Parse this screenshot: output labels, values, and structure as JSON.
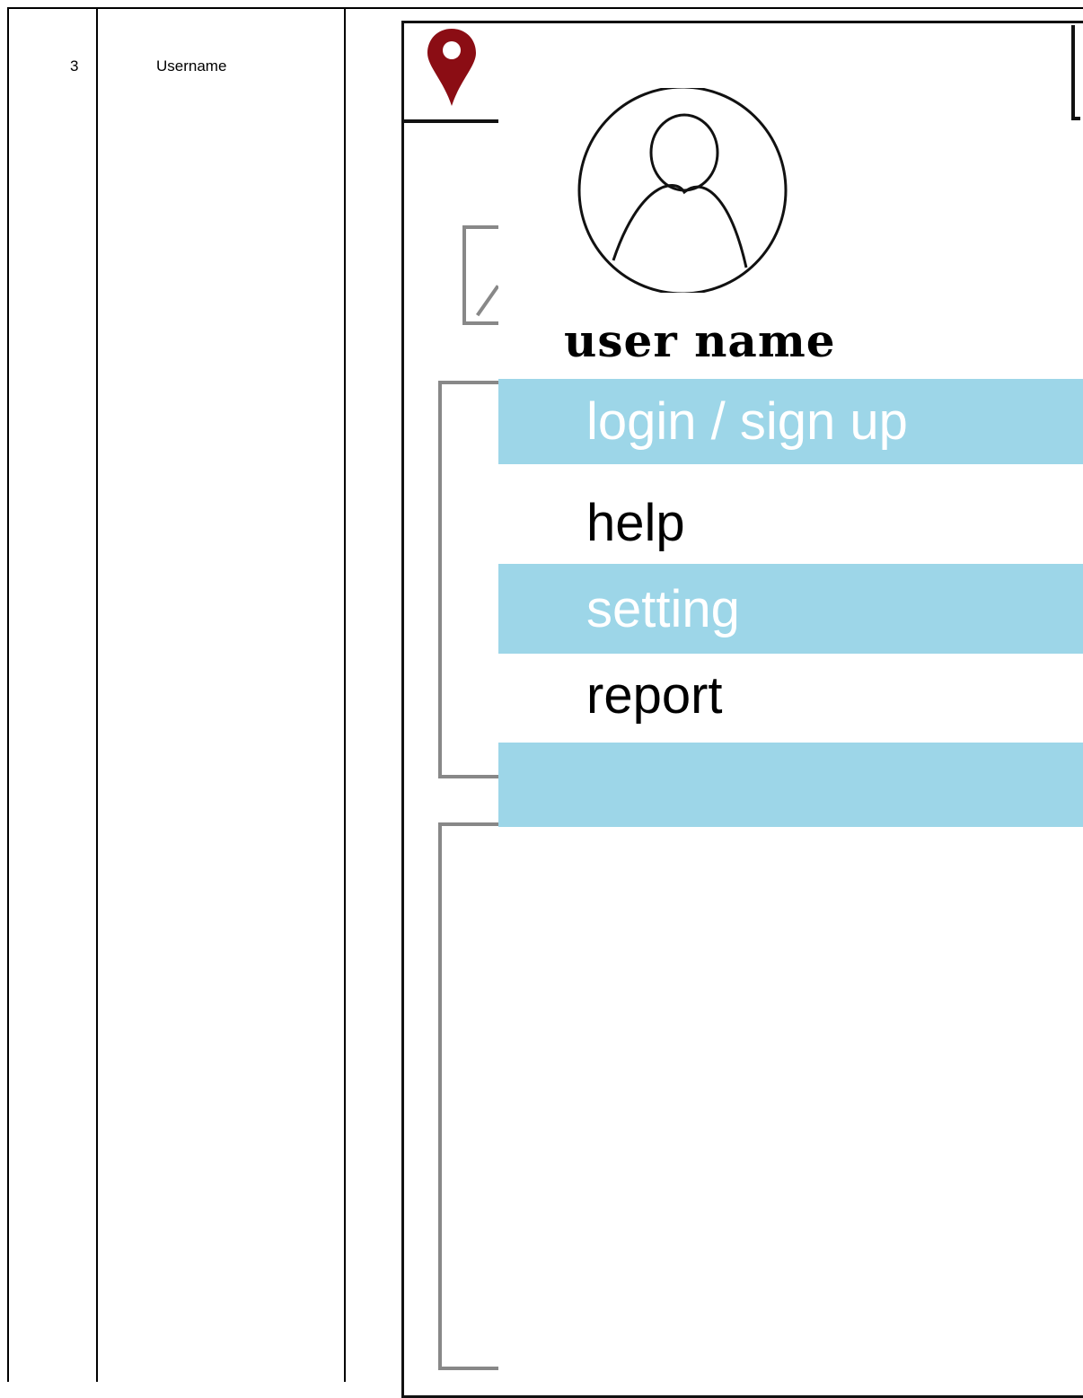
{
  "table": {
    "row_number": "3",
    "row_label": "Username"
  },
  "mockup": {
    "username": "user name",
    "menu": {
      "login": "login / sign up",
      "help": "help",
      "setting": "setting",
      "report": "report",
      "empty": ""
    },
    "colors": {
      "menu_highlight": "#9dd6e8",
      "pin": "#8b0d14"
    },
    "icons": [
      "map-pin-icon",
      "user-avatar-icon"
    ]
  }
}
